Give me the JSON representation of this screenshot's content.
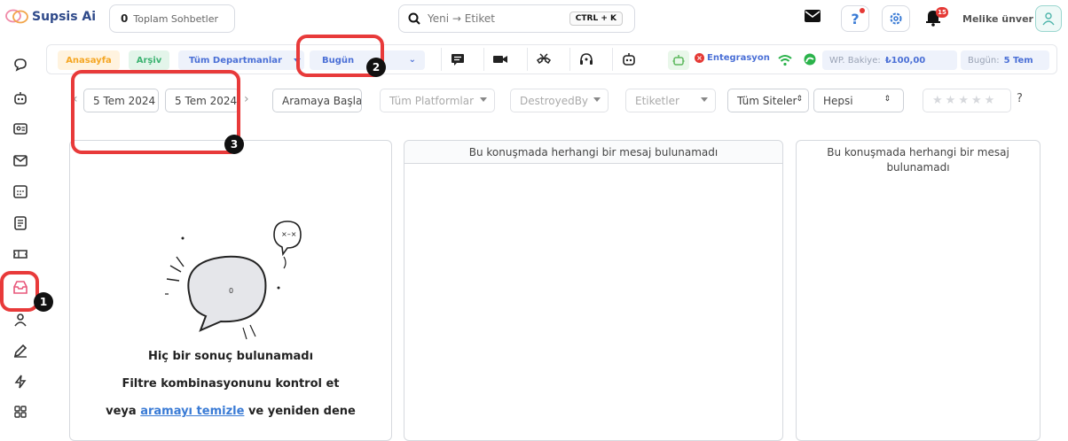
{
  "header": {
    "app_name": "Supsis Ai",
    "total_count": "0",
    "total_label": "Toplam Sohbetler",
    "search_placeholder": "Yeni → Etiket",
    "shortcut": "CTRL + K",
    "notification_count": "15",
    "user_name": "Melike ünver"
  },
  "sidebar": {
    "items": [
      {
        "icon": "chat-bubble-icon"
      },
      {
        "icon": "bot-icon"
      },
      {
        "icon": "contact-card-icon"
      },
      {
        "icon": "mail-icon"
      },
      {
        "icon": "calendar-icon"
      },
      {
        "icon": "notes-icon"
      },
      {
        "icon": "ticket-icon"
      },
      {
        "icon": "inbox-archive-icon",
        "active": true
      },
      {
        "icon": "users-icon"
      },
      {
        "icon": "pen-icon"
      },
      {
        "icon": "lightning-icon"
      },
      {
        "icon": "grid-icon"
      }
    ]
  },
  "tabs": {
    "home": "Anasayfa",
    "archive": "Arşiv",
    "departments": "Tüm Departmanlar",
    "date_range": "Bugün"
  },
  "toolbar": {
    "integration": "Entegrasyon",
    "wp_balance_label": "WP. Bakiye:",
    "wp_balance_value": "₺100,00",
    "today_label": "Bugün:",
    "today_value": "5 Tem"
  },
  "filters": {
    "start_date": "5 Tem 2024",
    "end_date": "5 Tem 2024",
    "search_button": "Aramaya Başla",
    "platforms": "Tüm Platformlar",
    "destroyed_by": "DestroyedBy",
    "tags": "Etiketler",
    "sites": "Tüm Siteler",
    "status": "Hepsi",
    "rating_help": "?"
  },
  "panels": {
    "left": {
      "empty_title": "Hiç bir sonuç bulunamadı",
      "empty_line2": "Filtre kombinasyonunu kontrol et",
      "empty_line3_prefix": "veya",
      "empty_link": "aramayı temizle",
      "empty_line3_suffix": "ve yeniden dene"
    },
    "middle_message": "Bu konuşmada herhangi bir mesaj bulunamadı",
    "right_message": "Bu konuşmada herhangi bir mesaj bulunamadı"
  },
  "annotations": [
    "1",
    "2",
    "3"
  ],
  "colors": {
    "accent": "#4a7bd6",
    "annotation_red": "#e83a3a",
    "home_tab": "#f5a623",
    "archive_tab": "#3cb371",
    "integration_red": "#e53935",
    "wifi_green": "#2bb34b"
  }
}
